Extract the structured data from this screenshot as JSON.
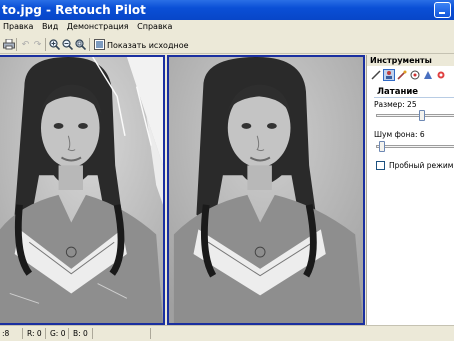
{
  "window": {
    "title": "to.jpg - Retouch Pilot"
  },
  "menu": [
    "Правка",
    "Вид",
    "Демонстрация",
    "Справка"
  ],
  "toolbar": {
    "show_original_label": "Показать исходное"
  },
  "panel": {
    "title": "Инструменты",
    "section_title": "Латание",
    "size_label": "Размер: 25",
    "size_value": 25,
    "noise_label": "Шум фона: 6",
    "noise_value": 6,
    "trial_mode_label": "Пробный режим",
    "trial_mode_checked": false
  },
  "status": {
    "a": ":8",
    "r": "R: 0",
    "g": "G: 0",
    "b": "B: 0"
  },
  "colors": {
    "title_bar": "#0a4fd6",
    "pane_border": "#1a2fa0"
  },
  "icons": [
    "print-icon",
    "undo-icon",
    "redo-icon",
    "zoom-in-icon",
    "zoom-out-icon",
    "zoom-fit-icon",
    "show-original-icon",
    "brush-icon",
    "stamp-icon",
    "patch-icon",
    "eye-icon",
    "sharpen-icon",
    "fill-icon"
  ]
}
